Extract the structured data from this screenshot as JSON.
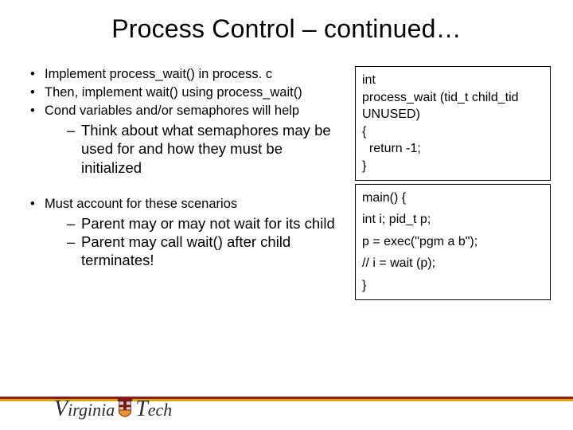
{
  "title": "Process Control – continued…",
  "left": {
    "b1": "Implement process_wait() in process. c",
    "b2": "Then, implement wait() using process_wait()",
    "b3": "Cond variables and/or semaphores will help",
    "b3_sub": "Think about what semaphores may be used for and how they must be initialized",
    "b4": "Must account for these scenarios",
    "b4_sub1": "Parent may or may not wait for its child",
    "b4_sub2": "Parent may call wait() after child terminates!"
  },
  "code1": {
    "l1": "int",
    "l2": "process_wait (tid_t child_tid UNUSED)",
    "l3": "{",
    "l4": "  return -1;",
    "l5": "}"
  },
  "code2": {
    "l1": "main() {",
    "l2": "int i; pid_t p;",
    "l3": "p = exec(\"pgm a b\");",
    "l4": "// i = wait (p);",
    "l5": "}"
  },
  "logo": {
    "v": "V",
    "irginia": "irginia",
    "t": "T",
    "ech": "ech"
  }
}
